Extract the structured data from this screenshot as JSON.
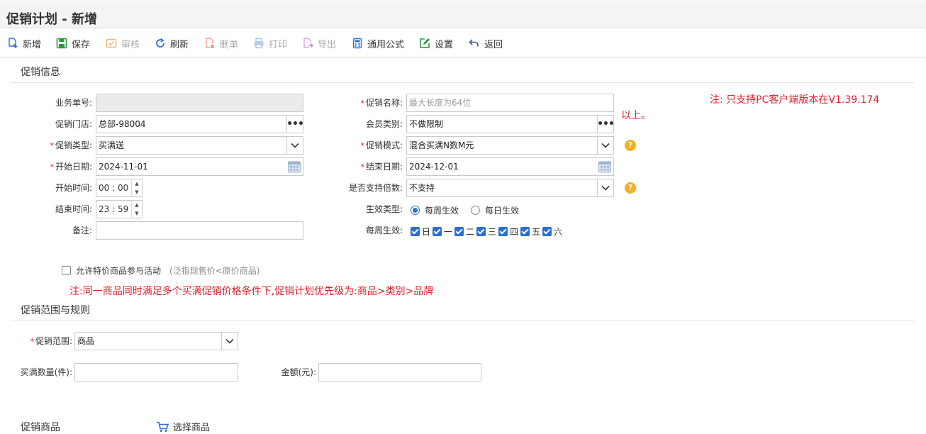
{
  "title": "促销计划 - 新增",
  "toolbar": {
    "new": "新增",
    "save": "保存",
    "audit": "审核",
    "refresh": "刷新",
    "delete": "删单",
    "print": "打印",
    "export": "导出",
    "formula": "通用公式",
    "settings": "设置",
    "back": "返回"
  },
  "colors": {
    "accent": "#2a6fd6",
    "required": "#e0202a",
    "help": "#f5b022"
  },
  "promo_info": {
    "section_title": "促销信息",
    "order_no_label": "业务单号:",
    "order_no_value": "",
    "store_label": "促销门店:",
    "store_value": "总部-98004",
    "type_label": "促销类型:",
    "type_value": "买满送",
    "start_date_label": "开始日期:",
    "start_date_value": "2024-11-01",
    "start_time_label": "开始时间:",
    "start_time_value": "00 : 00",
    "end_time_label": "结束时间:",
    "end_time_value": "23 : 59",
    "remark_label": "备注:",
    "remark_value": "",
    "name_label": "促销名称:",
    "name_placeholder": "最大长度为64位",
    "member_label": "会员类别:",
    "member_value": "不做限制",
    "mode_label": "促销模式:",
    "mode_value": "混合买满N数M元",
    "end_date_label": "结束日期:",
    "end_date_value": "2024-12-01",
    "multiple_label": "是否支持倍数:",
    "multiple_value": "不支持",
    "effect_type_label": "生效类型:",
    "effect_weekly": "每周生效",
    "effect_daily": "每日生效",
    "weekly_label": "每周生效:",
    "weekdays": [
      "日",
      "一",
      "二",
      "三",
      "四",
      "五",
      "六"
    ],
    "note_top_line1": "注: 只支持PC客户端版本在V1.39.174",
    "note_top_line2": "以上。",
    "allow_special_label": "允许特价商品参与活动",
    "allow_special_hint": "(泛指现售价<原价商品)",
    "priority_note": "注:同一商品同时满足多个买满促销价格条件下,促销计划优先级为:商品>类别>品牌"
  },
  "scope": {
    "section_title": "促销范围与规则",
    "scope_label": "促销范围:",
    "scope_value": "商品",
    "qty_label": "买满数量(件):",
    "qty_value": "",
    "amount_label": "金额(元):",
    "amount_value": ""
  },
  "goods": {
    "section_title": "促销商品",
    "select_label": "选择商品"
  }
}
